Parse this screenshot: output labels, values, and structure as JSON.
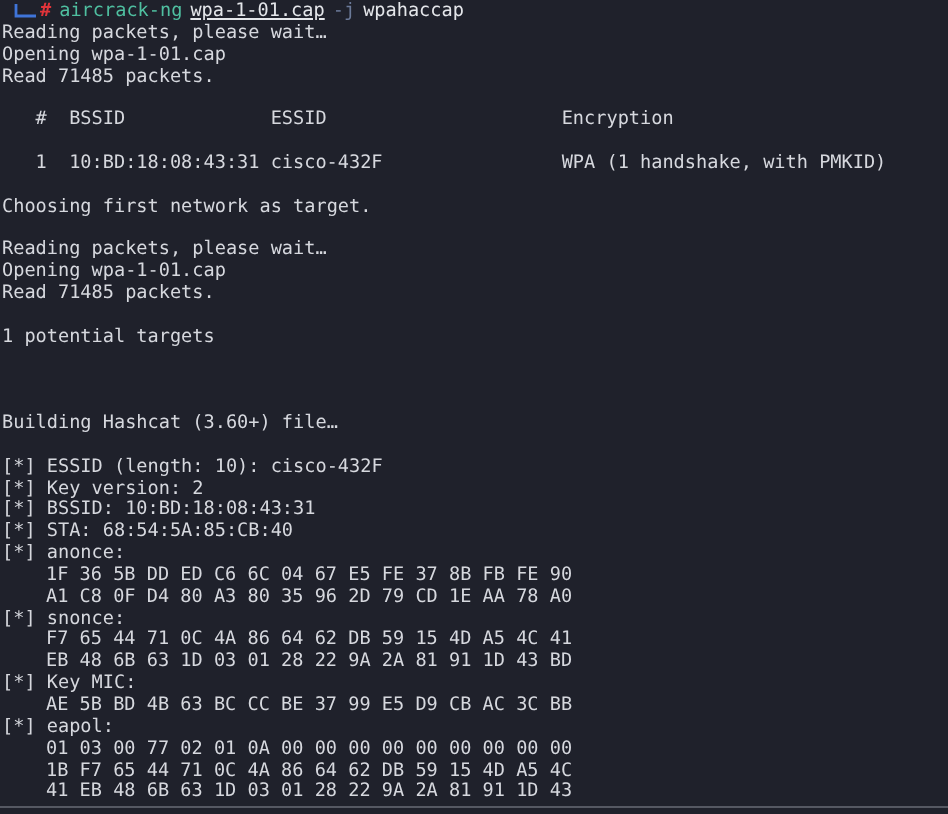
{
  "prompt": {
    "symbol": "#",
    "command": "aircrack-ng",
    "args": [
      {
        "kind": "file",
        "text": "wpa-1-01.cap"
      },
      {
        "kind": "flag",
        "text": "-j"
      },
      {
        "kind": "plain",
        "text": "wpahaccap"
      }
    ]
  },
  "lines": [
    {
      "kind": "text",
      "text": "Reading packets, please wait…"
    },
    {
      "kind": "text",
      "text": "Opening wpa-1-01.cap"
    },
    {
      "kind": "text",
      "text": "Read 71485 packets."
    },
    {
      "kind": "blank"
    },
    {
      "kind": "table_header",
      "cells": [
        "#",
        "BSSID",
        "ESSID",
        "Encryption"
      ]
    },
    {
      "kind": "blank"
    },
    {
      "kind": "table_row",
      "cells": [
        "1",
        "10:BD:18:08:43:31",
        "cisco-432F",
        "WPA (1 handshake, with PMKID)"
      ]
    },
    {
      "kind": "blank"
    },
    {
      "kind": "text",
      "text": "Choosing first network as target."
    },
    {
      "kind": "blank"
    },
    {
      "kind": "text",
      "text": "Reading packets, please wait…"
    },
    {
      "kind": "text",
      "text": "Opening wpa-1-01.cap"
    },
    {
      "kind": "text",
      "text": "Read 71485 packets."
    },
    {
      "kind": "blank"
    },
    {
      "kind": "text",
      "text": "1 potential targets"
    },
    {
      "kind": "blank"
    },
    {
      "kind": "blank"
    },
    {
      "kind": "blank"
    },
    {
      "kind": "text",
      "text": "Building Hashcat (3.60+) file…"
    },
    {
      "kind": "blank"
    },
    {
      "kind": "text",
      "text": "[*] ESSID (length: 10): cisco-432F"
    },
    {
      "kind": "text",
      "text": "[*] Key version: 2"
    },
    {
      "kind": "text",
      "text": "[*] BSSID: 10:BD:18:08:43:31"
    },
    {
      "kind": "text",
      "text": "[*] STA: 68:54:5A:85:CB:40"
    },
    {
      "kind": "text",
      "text": "[*] anonce:"
    },
    {
      "kind": "hex",
      "text": "1F 36 5B DD ED C6 6C 04 67 E5 FE 37 8B FB FE 90"
    },
    {
      "kind": "hex",
      "text": "A1 C8 0F D4 80 A3 80 35 96 2D 79 CD 1E AA 78 A0"
    },
    {
      "kind": "text",
      "text": "[*] snonce:"
    },
    {
      "kind": "hex",
      "text": "F7 65 44 71 0C 4A 86 64 62 DB 59 15 4D A5 4C 41"
    },
    {
      "kind": "hex",
      "text": "EB 48 6B 63 1D 03 01 28 22 9A 2A 81 91 1D 43 BD"
    },
    {
      "kind": "text",
      "text": "[*] Key MIC:"
    },
    {
      "kind": "hex",
      "text": "AE 5B BD 4B 63 BC CC BE 37 99 E5 D9 CB AC 3C BB"
    },
    {
      "kind": "text",
      "text": "[*] eapol:"
    },
    {
      "kind": "hex",
      "text": "01 03 00 77 02 01 0A 00 00 00 00 00 00 00 00 00"
    },
    {
      "kind": "hex",
      "text": "1B F7 65 44 71 0C 4A 86 64 62 DB 59 15 4D A5 4C"
    },
    {
      "kind": "hex",
      "text": "41 EB 48 6B 63 1D 03 01 28 22 9A 2A 81 91 1D 43"
    }
  ]
}
